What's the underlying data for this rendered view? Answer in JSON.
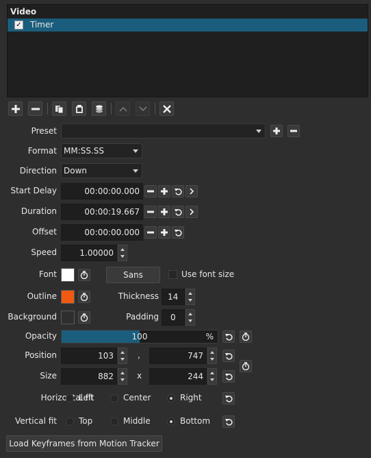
{
  "filters_panel": {
    "header": "Video",
    "items": [
      {
        "label": "Timer",
        "checked": true
      }
    ]
  },
  "toolbar": {
    "icons": [
      "add-icon",
      "remove-icon",
      "copy-icon",
      "paste-icon",
      "stack-icon",
      "move-up-icon",
      "move-down-icon",
      "close-icon"
    ]
  },
  "form": {
    "preset": {
      "label": "Preset",
      "value": ""
    },
    "format": {
      "label": "Format",
      "value": "MM:SS.SS"
    },
    "direction": {
      "label": "Direction",
      "value": "Down"
    },
    "start_delay": {
      "label": "Start Delay",
      "value": "00:00:00.000"
    },
    "duration": {
      "label": "Duration",
      "value": "00:00:19.667"
    },
    "offset": {
      "label": "Offset",
      "value": "00:00:00.000"
    },
    "speed": {
      "label": "Speed",
      "value": "1.00000"
    },
    "font": {
      "label": "Font",
      "color": "#ffffff",
      "button": "Sans",
      "use_font_size": "Use font size"
    },
    "outline": {
      "label": "Outline",
      "color": "#f05a10"
    },
    "thickness": {
      "label": "Thickness",
      "value": "14"
    },
    "background": {
      "label": "Background",
      "color": "#2e2e2e"
    },
    "padding": {
      "label": "Padding",
      "value": "0"
    },
    "opacity": {
      "label": "Opacity",
      "value": "100",
      "unit": "%",
      "level": 0.5
    },
    "position": {
      "label": "Position",
      "x": "103",
      "sep": ",",
      "y": "747"
    },
    "size": {
      "label": "Size",
      "w": "882",
      "sep": "x",
      "h": "244"
    },
    "horizontal_fit": {
      "label": "Horizontal fit",
      "options": [
        "Left",
        "Center",
        "Right"
      ],
      "selected": "Right"
    },
    "vertical_fit": {
      "label": "Vertical fit",
      "options": [
        "Top",
        "Middle",
        "Bottom"
      ],
      "selected": "Bottom"
    },
    "load_keyframes": "Load Keyframes from Motion Tracker"
  },
  "colors": {
    "accent": "#1b5d7c",
    "panel_bg": "#2e2e2e"
  }
}
